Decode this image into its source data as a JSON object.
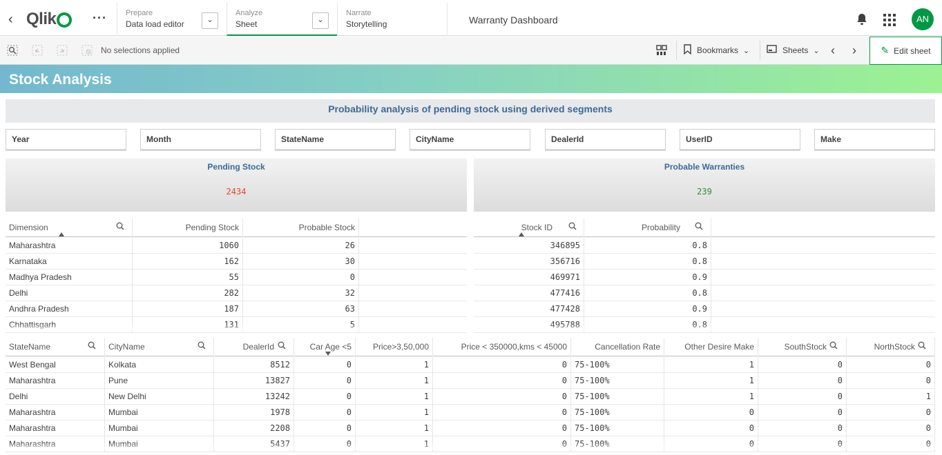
{
  "nav": {
    "logo": "Qlik",
    "prepare": {
      "kicker": "Prepare",
      "value": "Data load editor"
    },
    "analyze": {
      "kicker": "Analyze",
      "value": "Sheet"
    },
    "narrate": {
      "kicker": "Narrate",
      "value": "Storytelling"
    },
    "app_title": "Warranty Dashboard",
    "avatar_initials": "AN"
  },
  "toolbar": {
    "selections_text": "No selections applied",
    "bookmarks_label": "Bookmarks",
    "sheets_label": "Sheets",
    "edit_sheet_label": "Edit sheet"
  },
  "sheet": {
    "title": "Stock Analysis",
    "banner": "Probability analysis of pending stock using derived segments"
  },
  "filters": [
    "Year",
    "Month",
    "StateName",
    "CityName",
    "DealerId",
    "UserID",
    "Make"
  ],
  "kpis": [
    {
      "title": "Pending Stock",
      "value": "2434",
      "color": "#e8432e"
    },
    {
      "title": "Probable Warranties",
      "value": "239",
      "color": "#2e8b3c"
    }
  ],
  "dimension_table": {
    "columns": [
      "Dimension",
      "Pending Stock",
      "Probable Stock"
    ],
    "rows": [
      [
        "Maharashtra",
        "1060",
        "26"
      ],
      [
        "Karnataka",
        "162",
        "30"
      ],
      [
        "Madhya Pradesh",
        "55",
        "0"
      ],
      [
        "Delhi",
        "282",
        "32"
      ],
      [
        "Andhra Pradesh",
        "187",
        "63"
      ],
      [
        "Chhattisgarh",
        "131",
        "5"
      ]
    ]
  },
  "stock_table": {
    "columns": [
      "Stock ID",
      "Probability"
    ],
    "rows": [
      [
        "346895",
        "0.8"
      ],
      [
        "356716",
        "0.8"
      ],
      [
        "469971",
        "0.9"
      ],
      [
        "477416",
        "0.8"
      ],
      [
        "477428",
        "0.9"
      ],
      [
        "495788",
        "0.8"
      ]
    ]
  },
  "detail_table": {
    "columns": [
      "StateName",
      "CityName",
      "DealerId",
      "Car Age <5",
      "Price>3,50,000",
      "Price < 350000,kms < 45000",
      "Cancellation Rate",
      "Other Desire Make",
      "SouthStock",
      "NorthStock"
    ],
    "rows": [
      [
        "West Bengal",
        "Kolkata",
        "8512",
        "0",
        "1",
        "0",
        "75-100%",
        "1",
        "0",
        "0"
      ],
      [
        "Maharashtra",
        "Pune",
        "13827",
        "0",
        "1",
        "0",
        "75-100%",
        "1",
        "0",
        "0"
      ],
      [
        "Delhi",
        "New Delhi",
        "13242",
        "0",
        "1",
        "0",
        "75-100%",
        "1",
        "0",
        "1"
      ],
      [
        "Maharashtra",
        "Mumbai",
        "1978",
        "0",
        "1",
        "0",
        "75-100%",
        "0",
        "0",
        "0"
      ],
      [
        "Maharashtra",
        "Mumbai",
        "2208",
        "0",
        "1",
        "0",
        "75-100%",
        "0",
        "0",
        "0"
      ],
      [
        "Maharashtra",
        "Mumbai",
        "5437",
        "0",
        "1",
        "0",
        "75-100%",
        "0",
        "0",
        "0"
      ]
    ]
  },
  "colors": {
    "accent": "#009845",
    "banner_text": "#3b6a98"
  }
}
